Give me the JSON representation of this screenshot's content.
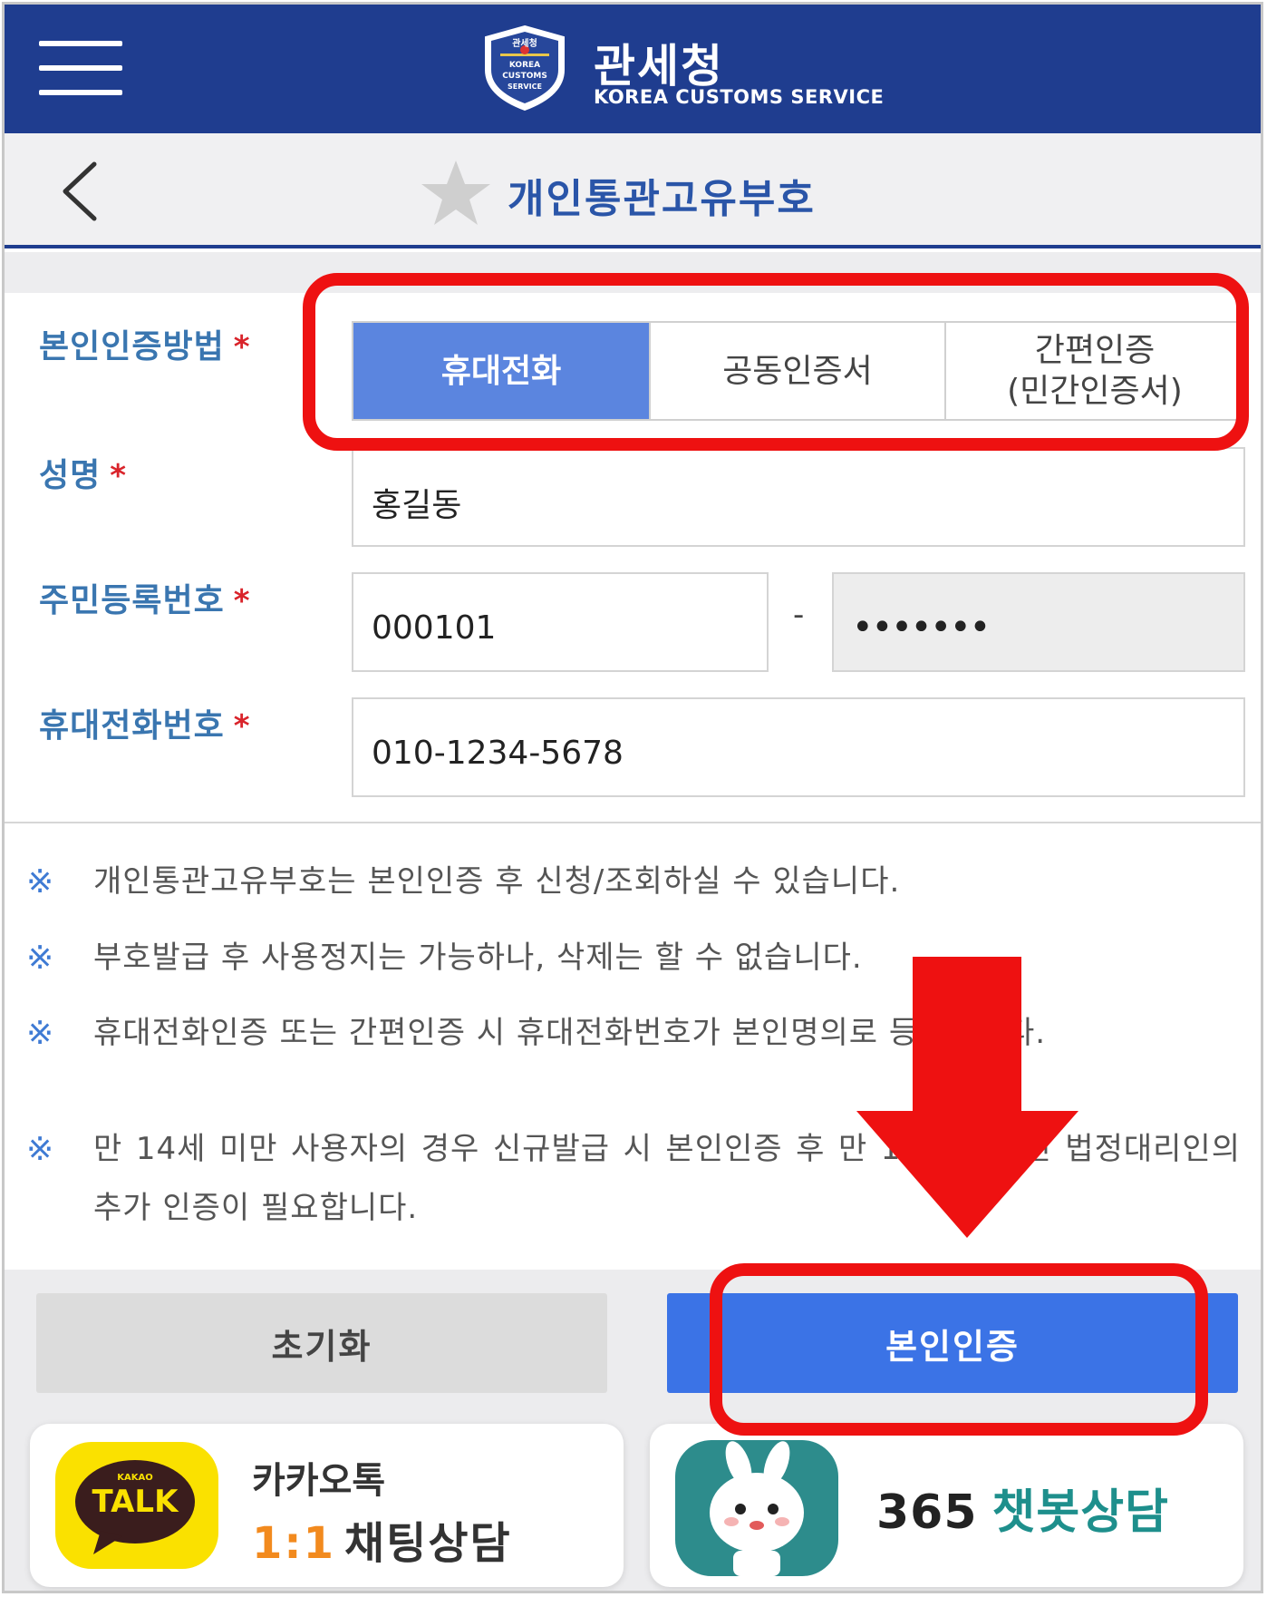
{
  "header": {
    "brand_name": "관세청",
    "brand_sub": "KOREA CUSTOMS SERVICE",
    "emblem_lines": [
      "관세청",
      "KOREA",
      "CUSTOMS",
      "SERVICE"
    ],
    "menu_icon": "hamburger-menu-icon",
    "bg_color": "#1f3d8f"
  },
  "titlebar": {
    "title": "개인통관고유부호",
    "back_icon": "chevron-left-icon",
    "favorite_icon": "star-icon"
  },
  "form": {
    "auth_method_label": "본인인증방법",
    "auth_methods": [
      "휴대전화",
      "공동인증서",
      "간편인증\n(민간인증서)"
    ],
    "selected_method": "휴대전화",
    "name_label": "성명",
    "name_value": "홍길동",
    "rrn_label": "주민등록번호",
    "rrn_front": "000101",
    "rrn_separator": "-",
    "rrn_back_masked": "•••••••",
    "phone_label": "휴대전화번호",
    "phone_value": "010-1234-5678",
    "required_mark": "*",
    "accent_color": "#5b85df"
  },
  "notes": {
    "mark": "※",
    "items": [
      "개인통관고유부호는 본인인증 후 신청/조회하실 수 있습니다.",
      "부호발급 후 사용정지는 가능하나, 삭제는 할 수 없습니다.",
      "휴대전화인증 또는 간편인증 시 휴대전화번호가 본인명의로 등록됩니다.",
      "만 14세 미만 사용자의 경우 신규발급 시 본인인증 후 만 19세 이상인 법정대리인의 추가 인증이 필요합니다."
    ]
  },
  "actions": {
    "reset_label": "초기화",
    "auth_label": "본인인증",
    "auth_color": "#3b73e6"
  },
  "banners": {
    "kakao_icon_text": "TALK",
    "kakao_icon_small": "KAKAO",
    "kakao_line1": "카카오톡",
    "kakao_num": "1:1",
    "kakao_line2": "채팅상담",
    "chat_num": "365",
    "chat_text": "챗봇상담",
    "kakao_icon": "kakao-talk-icon",
    "chatbot_icon": "rabbit-chatbot-icon"
  },
  "annotations": {
    "highlight_color": "#ee1111",
    "arrow_icon": "down-arrow-icon"
  }
}
